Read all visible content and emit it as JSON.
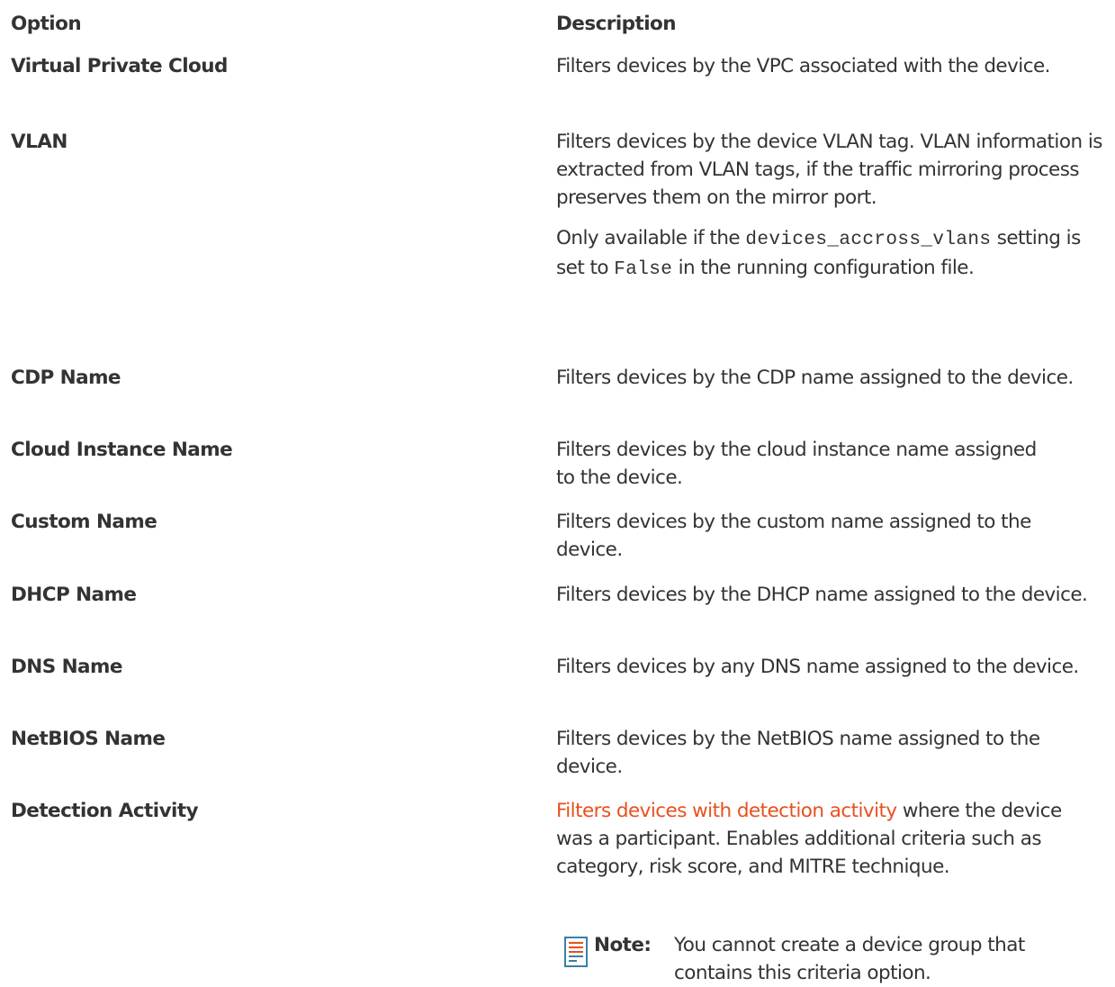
{
  "table": {
    "header": {
      "option": "Option",
      "description": "Description"
    },
    "rows": [
      {
        "option": "Virtual Private Cloud",
        "description": "Filters devices by the VPC associated with the device."
      },
      {
        "option": "VLAN",
        "description": "Filters devices by the device VLAN tag. VLAN information is extracted from VLAN tags, if the traffic mirroring process preserves them on the mirror port.",
        "extra_before_code": "Only available if the ",
        "extra_code_1": "devices_accross_vlans",
        "extra_middle": " setting is set to ",
        "extra_code_2": "False",
        "extra_after": " in the running configuration file."
      },
      {
        "option": "CDP Name",
        "description": "Filters devices by the CDP name assigned to the device."
      },
      {
        "option": "Cloud Instance Name",
        "description": "Filters devices by the cloud instance name assigned to the device."
      },
      {
        "option": "Custom Name",
        "description": "Filters devices by the custom name assigned to the device."
      },
      {
        "option": "DHCP Name",
        "description": "Filters devices by the DHCP name assigned to the device."
      },
      {
        "option": "DNS Name",
        "description": "Filters devices by any DNS name assigned to the device."
      },
      {
        "option": "NetBIOS Name",
        "description": "Filters devices by the NetBIOS name assigned to the device."
      },
      {
        "option": "Detection Activity",
        "link_text": "Filters devices with detection activity",
        "description_after_link": " where the device was a participant. Enables additional criteria such as category, risk score, and MITRE technique.",
        "note_label": "Note:",
        "note_text": "You cannot create a device group that contains this criteria option."
      }
    ]
  },
  "colors": {
    "text": "#333333",
    "link": "#e8501e",
    "note_icon_lines": "#e8501e",
    "note_icon_border": "#3a7fa8"
  },
  "icons": {
    "note": "note-icon"
  }
}
